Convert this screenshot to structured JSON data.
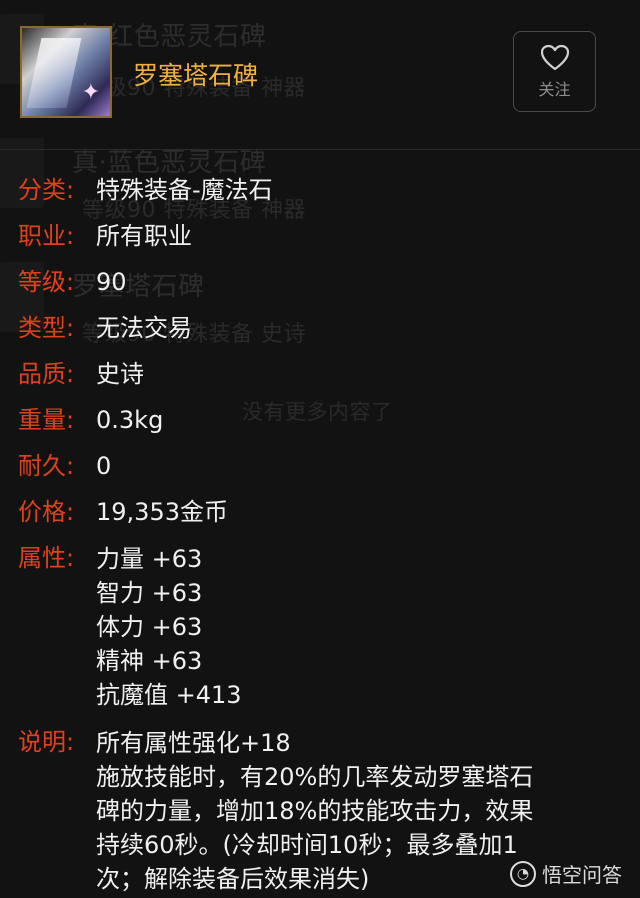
{
  "item": {
    "name": "罗塞塔石碑",
    "follow_label": "关注"
  },
  "background_list": [
    {
      "title": "真·红色恶灵石碑",
      "sub": "等级90 特殊装备 神器"
    },
    {
      "title": "真·蓝色恶灵石碑",
      "sub": "等级90 特殊装备 神器"
    },
    {
      "title": "罗塞塔石碑",
      "sub": "等级90 特殊装备 史诗"
    }
  ],
  "background_empty_text": "没有更多内容了",
  "attributes": {
    "category": {
      "label": "分类:",
      "value": "特殊装备-魔法石"
    },
    "job": {
      "label": "职业:",
      "value": "所有职业"
    },
    "level": {
      "label": "等级:",
      "value": "90"
    },
    "type": {
      "label": "类型:",
      "value": "无法交易"
    },
    "quality": {
      "label": "品质:",
      "value": "史诗"
    },
    "weight": {
      "label": "重量:",
      "value": "0.3kg"
    },
    "durability": {
      "label": "耐久:",
      "value": "0"
    },
    "price": {
      "label": "价格:",
      "value": "19,353金币"
    },
    "stats": {
      "label": "属性:",
      "lines": [
        "力量 +63",
        "智力 +63",
        "体力 +63",
        "精神 +63",
        "抗魔值 +413"
      ]
    },
    "description": {
      "label": "说明:",
      "lines": [
        "所有属性强化+18",
        "施放技能时，有20%的几率发动罗塞塔石",
        "碑的力量，增加18%的技能攻击力，效果",
        "持续60秒。(冷却时间10秒；最多叠加1",
        "次；解除装备后效果消失)"
      ]
    }
  },
  "watermark": {
    "text": "悟空问答"
  },
  "colors": {
    "label": "#e0401c",
    "item_name": "#f0b040",
    "background": "#121212"
  },
  "icons": {
    "follow": "heart-icon",
    "item": "item-stone-icon"
  }
}
